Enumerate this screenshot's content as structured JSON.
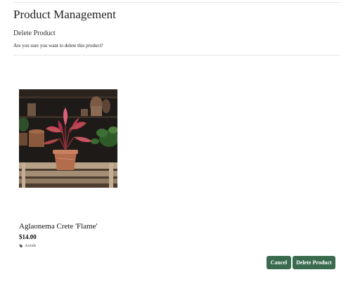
{
  "header": {
    "title": "Product Management",
    "breadcrumb_link": "Delete Product",
    "confirm_message": "Are you sure you want to delete this product?"
  },
  "product": {
    "name": "Aglaonema Crete 'Flame'",
    "price": "$14.00",
    "category": "Aroids",
    "category_icon": "tag-icon",
    "image_subject": "potted-plant"
  },
  "actions": {
    "cancel_label": "Cancel",
    "delete_label": "Delete Product"
  },
  "colors": {
    "button_bg": "#3a6b4f",
    "button_text": "#ffffff"
  }
}
